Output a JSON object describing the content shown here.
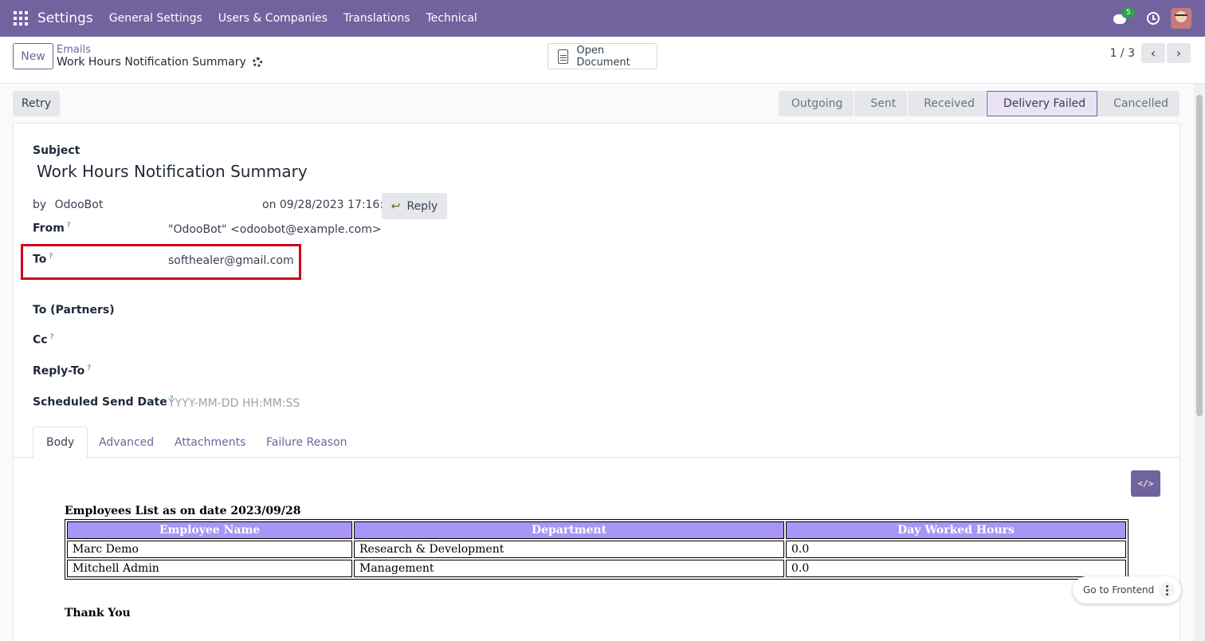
{
  "navbar": {
    "app_name": "Settings",
    "menu": [
      "General Settings",
      "Users & Companies",
      "Translations",
      "Technical"
    ],
    "messages_count": "5",
    "bg_color": "#71639e"
  },
  "control_panel": {
    "new_label": "New",
    "breadcrumb": "Emails",
    "record_title": "Work Hours Notification Summary",
    "open_document_label": "Open Document",
    "pager": "1 / 3",
    "prev_icon": "‹",
    "next_icon": "›"
  },
  "statusbar": {
    "retry_label": "Retry",
    "steps": [
      "Outgoing",
      "Sent",
      "Received",
      "Delivery Failed",
      "Cancelled"
    ],
    "active_step": "Delivery Failed"
  },
  "form": {
    "subject_label": "Subject",
    "subject_value": "Work Hours Notification Summary",
    "by_prefix": "by",
    "author": "OdooBot",
    "date_text": "on 09/28/2023 17:16:17",
    "reply_label": "Reply",
    "from_label": "From",
    "from_value": "\"OdooBot\" <odoobot@example.com>",
    "to_label": "To",
    "to_value": "softhealer@gmail.com",
    "to_partners_label": "To (Partners)",
    "cc_label": "Cc",
    "reply_to_label": "Reply-To",
    "scheduled_label": "Scheduled Send Date",
    "scheduled_placeholder": "YYYY-MM-DD HH:MM:SS",
    "help_mark": "?"
  },
  "tabs": [
    "Body",
    "Advanced",
    "Attachments",
    "Failure Reason"
  ],
  "body": {
    "code_view_icon": "</>",
    "heading": "Employees List as on date 2023/09/28",
    "columns": [
      "Employee Name",
      "Department",
      "Day Worked Hours"
    ],
    "rows": [
      [
        "Marc Demo",
        "Research & Development",
        "0.0"
      ],
      [
        "Mitchell Admin",
        "Management",
        "0.0"
      ]
    ],
    "closing": "Thank You"
  },
  "floating": {
    "go_frontend_label": "Go to Frontend"
  }
}
